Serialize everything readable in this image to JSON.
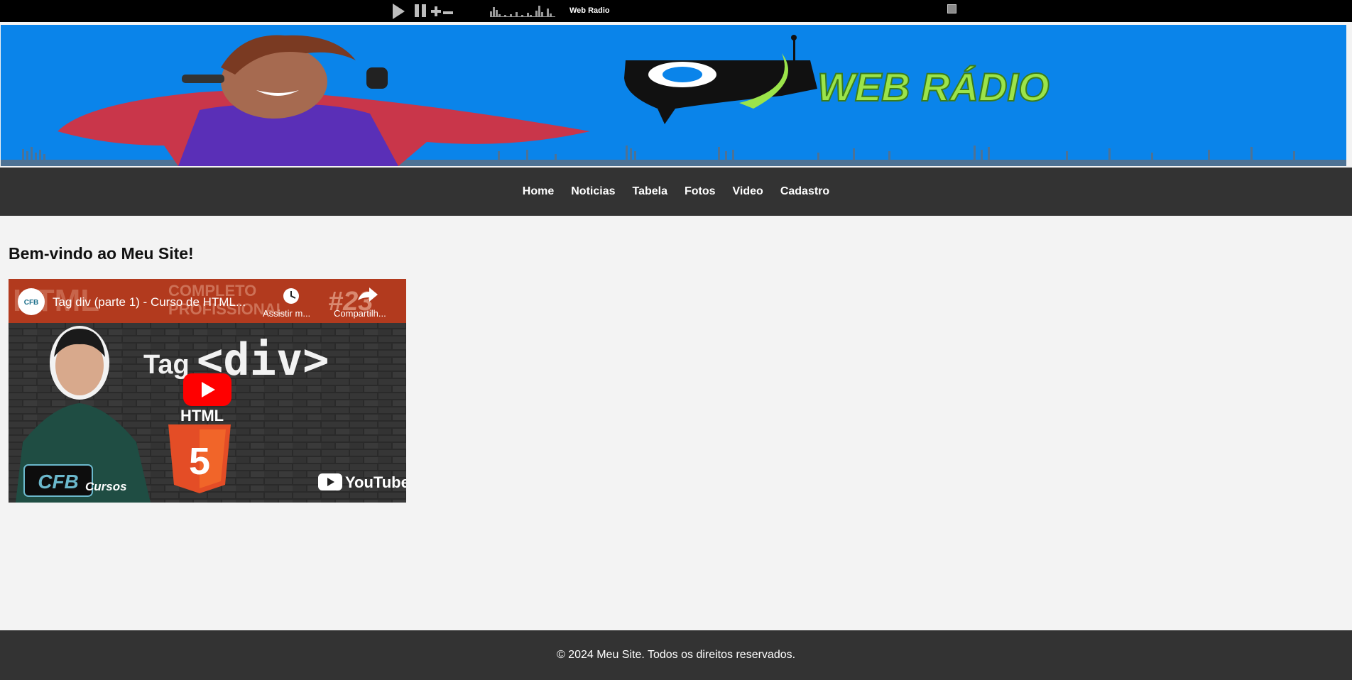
{
  "player": {
    "title": "Web Radio",
    "play_icon": "play-icon",
    "pause_icon": "pause-icon",
    "volume_up_icon": "plus-icon",
    "volume_down_icon": "minus-icon"
  },
  "banner": {
    "logo_text": "WEB RÁDIO",
    "background_color": "#0a84ea",
    "accent_color": "#9be44a"
  },
  "nav": {
    "items": [
      {
        "label": "Home"
      },
      {
        "label": "Noticias"
      },
      {
        "label": "Tabela"
      },
      {
        "label": "Fotos"
      },
      {
        "label": "Video"
      },
      {
        "label": "Cadastro"
      }
    ]
  },
  "main": {
    "heading": "Bem-vindo ao Meu Site!"
  },
  "video": {
    "title": "Tag div (parte 1) - Curso de HTML...",
    "channel_avatar_text": "CFB",
    "watch_later_label": "Assistir m...",
    "share_label": "Compartilh...",
    "banner_text": "HTML COMPLETO PROFISSIONAL",
    "episode": "#23",
    "tag_label": "Tag",
    "tag_code": "<div>",
    "html_label": "HTML",
    "html_version": "5",
    "brand": "CFB",
    "brand_sub": "Cursos",
    "youtube_label": "YouTube"
  },
  "footer": {
    "text": "© 2024 Meu Site. Todos os direitos reservados."
  }
}
